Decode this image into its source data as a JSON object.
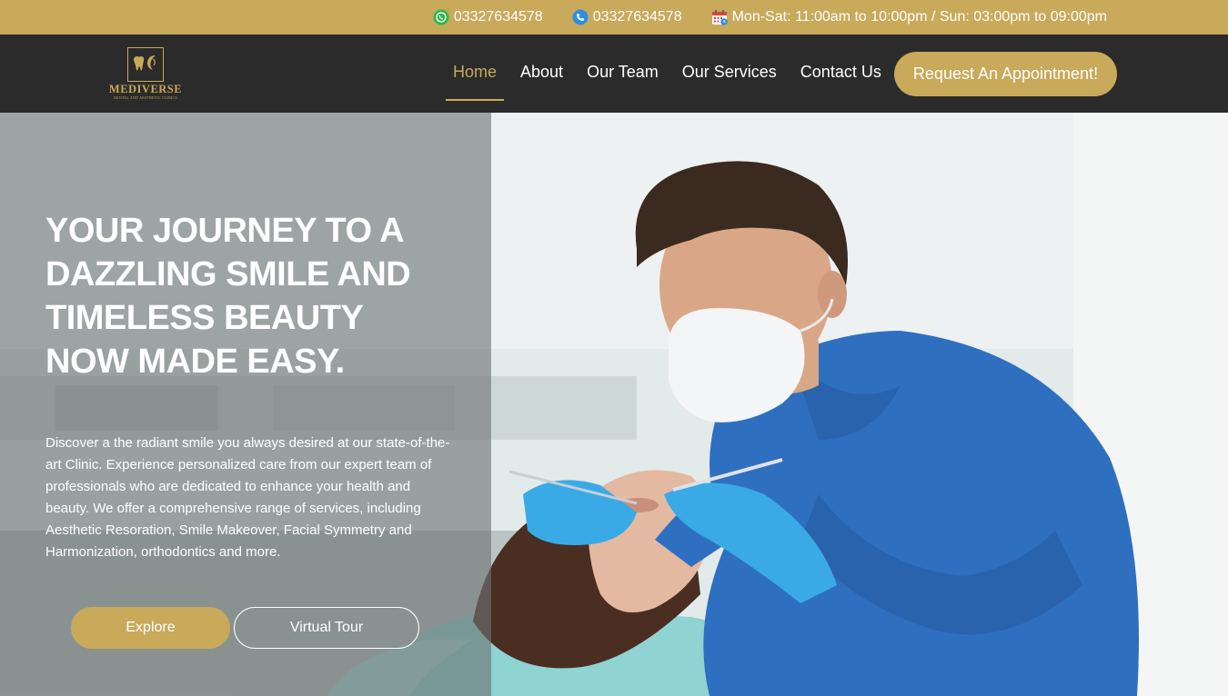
{
  "topbar": {
    "whatsapp_icon": "whatsapp-icon",
    "whatsapp_number": "03327634578",
    "phone_icon": "phone-icon",
    "phone_number": "03327634578",
    "calendar_icon": "calendar-icon",
    "hours": "Mon-Sat: 11:00am to 10:00pm / Sun: 03:00pm to 09:00pm"
  },
  "header": {
    "logo": {
      "name": "MEDIVERSE",
      "tagline": "DENTAL AND AESTHETIC CLINICS"
    },
    "nav": [
      {
        "label": "Home",
        "active": true
      },
      {
        "label": "About",
        "active": false
      },
      {
        "label": "Our Team",
        "active": false
      },
      {
        "label": "Our Services",
        "active": false
      },
      {
        "label": "Contact Us",
        "active": false
      }
    ],
    "cta_label": "Request An Appointment!"
  },
  "hero": {
    "headline": "YOUR JOURNEY TO A DAZZLING SMILE AND TIMELESS BEAUTY NOW MADE EASY.",
    "description": "Discover a the radiant smile you always desired at our state-of-the-art Clinic. Experience personalized care from our expert team of professionals who are dedicated to enhance your health and beauty. We offer a comprehensive range of services, including Aesthetic Resoration, Smile Makeover, Facial Symmetry and Harmonization, orthodontics and more.",
    "explore_label": "Explore",
    "tour_label": "Virtual Tour"
  },
  "colors": {
    "accent": "#c9a95a",
    "header_bg": "#2b2b2b",
    "scrub_blue": "#2f6fc0",
    "glove_blue": "#39a9e6"
  }
}
